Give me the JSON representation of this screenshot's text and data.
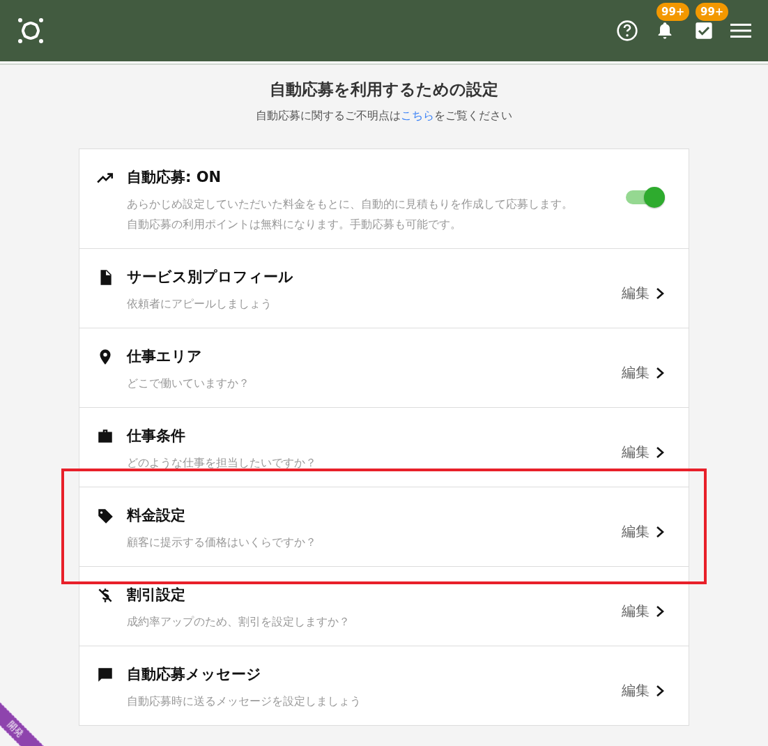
{
  "header": {
    "notifications_badge": "99+",
    "tasks_badge": "99+"
  },
  "page": {
    "title": "自動応募を利用するための設定",
    "subtitle_before": "自動応募に関するご不明点は",
    "subtitle_link": "こちら",
    "subtitle_after": "をご覧ください"
  },
  "items": [
    {
      "kind": "toggle",
      "title": "自動応募: ON",
      "description": "あらかじめ設定していただいた料金をもとに、自動的に見積もりを作成して応募します。自動応募の利用ポイントは無料になります。手動応募も可能です。",
      "on": true,
      "highlighted": false
    },
    {
      "kind": "edit",
      "title": "サービス別プロフィール",
      "description": "依頼者にアピールしましょう",
      "action": "編集",
      "highlighted": false
    },
    {
      "kind": "edit",
      "title": "仕事エリア",
      "description": "どこで働いていますか？",
      "action": "編集",
      "highlighted": false
    },
    {
      "kind": "edit",
      "title": "仕事条件",
      "description": "どのような仕事を担当したいですか？",
      "action": "編集",
      "highlighted": false
    },
    {
      "kind": "edit",
      "title": "料金設定",
      "description": "顧客に提示する価格はいくらですか？",
      "action": "編集",
      "highlighted": true
    },
    {
      "kind": "edit",
      "title": "割引設定",
      "description": "成約率アップのため、割引を設定しますか？",
      "action": "編集",
      "highlighted": false
    },
    {
      "kind": "edit",
      "title": "自動応募メッセージ",
      "description": "自動応募時に送るメッセージを設定しましょう",
      "action": "編集",
      "highlighted": false
    }
  ],
  "ribbon": {
    "label": "開発"
  }
}
